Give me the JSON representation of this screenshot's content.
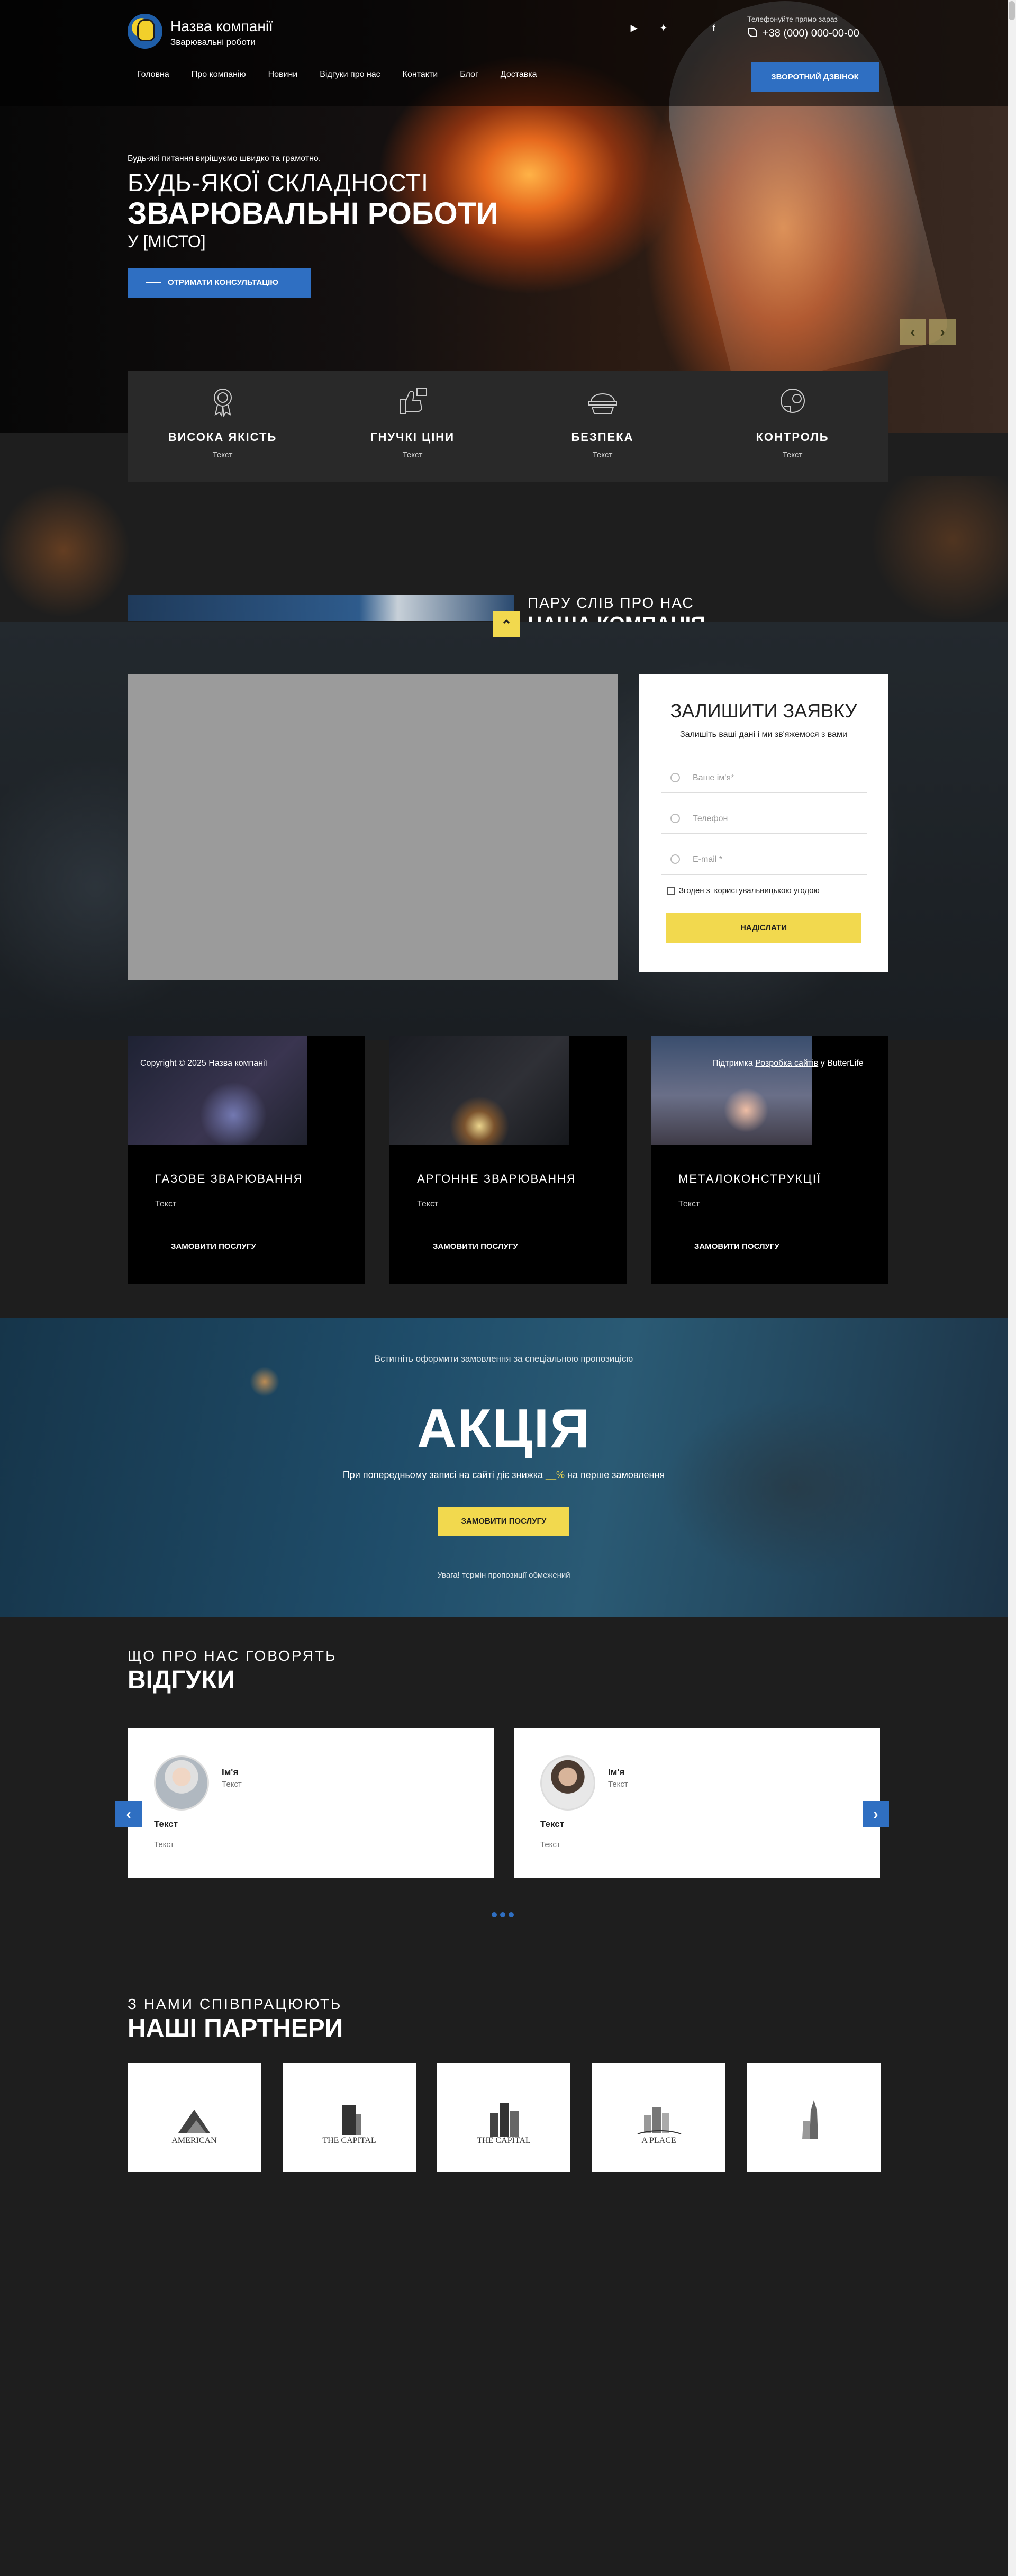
{
  "header": {
    "brand_name": "Назва компанії",
    "brand_sub": "Зварювальні роботи",
    "phone_label": "Телефонуйте прямо зараз",
    "phone_number": "+38 (000) 000-00-00",
    "callback_button": "ЗВОРОТНИЙ ДЗВІНОК",
    "social": [
      "youtube-icon",
      "twitter-icon",
      "facebook-icon"
    ],
    "social_glyphs": [
      "▶",
      "✦",
      "f"
    ],
    "nav": [
      "Головна",
      "Про компанію",
      "Новини",
      "Відгуки про нас",
      "Контакти",
      "Блог",
      "Доставка"
    ]
  },
  "hero": {
    "tagline": "Будь-які питання вирішуємо швидко та грамотно.",
    "title_line1": "БУДЬ-ЯКОЇ СКЛАДНОСТІ",
    "title_line2": "ЗВАРЮВАЛЬНІ РОБОТИ",
    "title_line3": "У [МІСТО]",
    "consult_button": "ОТРИМАТИ КОНСУЛЬТАЦІЮ",
    "prev": "‹",
    "next": "›"
  },
  "features": [
    {
      "title": "ВИСОКА ЯКІСТЬ",
      "text": "Текст",
      "icon": "award-icon"
    },
    {
      "title": "ГНУЧКІ ЦІНИ",
      "text": "Текст",
      "icon": "price-tag-icon"
    },
    {
      "title": "БЕЗПЕКА",
      "text": "Текст",
      "icon": "helmet-icon"
    },
    {
      "title": "КОНТРОЛЬ",
      "text": "Текст",
      "icon": "control-gear-icon"
    }
  ],
  "about": {
    "kicker": "ПАРУ СЛІВ ПРО НАС",
    "title": "НАША КОМПАНІЯ",
    "scroll_top": "⌃"
  },
  "contact_form": {
    "title": "ЗАЛИШИТИ ЗАЯВКУ",
    "subtitle": "Залишіть ваші дані і ми зв'яжемося з вами",
    "name_placeholder": "Ваше ім'я*",
    "phone_placeholder": "Телефон",
    "email_placeholder": "E-mail *",
    "consent_prefix": "Згоден з",
    "consent_link": "користувальницькою угодою",
    "submit": "НАДІСЛАТИ"
  },
  "footer_strip": {
    "copyright": "Copyright © 2025 Назва компанії",
    "credit_prefix": "Підтримка",
    "credit_link": "Розробка сайтів",
    "credit_suffix": "у ButterLife"
  },
  "services": [
    {
      "title": "ГАЗОВЕ ЗВАРЮВАННЯ",
      "text": "Текст",
      "button": "ЗАМОВИТИ ПОСЛУГУ"
    },
    {
      "title": "АРГОННЕ ЗВАРЮВАННЯ",
      "text": "Текст",
      "button": "ЗАМОВИТИ ПОСЛУГУ"
    },
    {
      "title": "МЕТАЛОКОНСТРУКЦІЇ",
      "text": "Текст",
      "button": "ЗАМОВИТИ ПОСЛУГУ"
    }
  ],
  "promo": {
    "kicker": "Встигніть оформити замовлення за спеціальною пропозицією",
    "title": "АКЦІЯ",
    "desc_prefix": "При попередньому записі на сайті діє знижка",
    "desc_pct": "__%",
    "desc_suffix": "на перше замовлення",
    "button": "ЗАМОВИТИ ПОСЛУГУ",
    "note": "Увага! термін пропозиції обмежений"
  },
  "reviews": {
    "kicker": "ЩО ПРО НАС ГОВОРЯТЬ",
    "title": "ВІДГУКИ",
    "items": [
      {
        "name": "Ім'я",
        "sub": "Текст",
        "head": "Текст",
        "body": "Текст"
      },
      {
        "name": "Ім'я",
        "sub": "Текст",
        "head": "Текст",
        "body": "Текст"
      }
    ],
    "prev": "‹",
    "next": "›"
  },
  "partners": {
    "kicker": "З НАМИ СПІВПРАЦЮЮТЬ",
    "title": "НАШІ ПАРТНЕРИ",
    "items": [
      "AMERICAN",
      "THE CAPITAL",
      "THE CAPITAL",
      "A PLACE",
      ""
    ]
  },
  "colors": {
    "accent_blue": "#2f6fc2",
    "accent_yellow": "#f2d94e",
    "background": "#1e1e1e"
  }
}
